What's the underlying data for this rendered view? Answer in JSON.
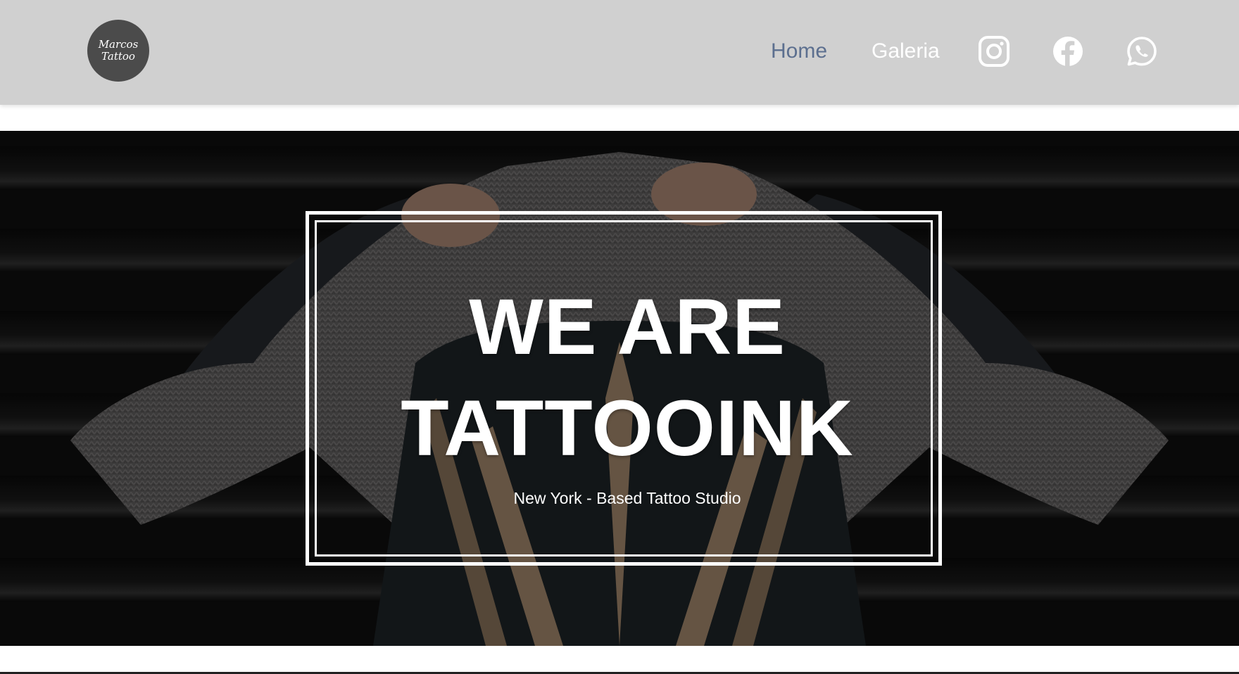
{
  "header": {
    "logo": {
      "line1": "Marcos",
      "line2": "Tattoo"
    },
    "nav": [
      {
        "label": "Home",
        "active": true
      },
      {
        "label": "Galeria",
        "active": false
      }
    ],
    "social": [
      {
        "name": "instagram-icon"
      },
      {
        "name": "facebook-icon"
      },
      {
        "name": "whatsapp-icon"
      }
    ]
  },
  "hero": {
    "title_line1": "WE ARE",
    "title_line2": "TATTOOINK",
    "subtitle": "New York - Based Tattoo Studio"
  },
  "colors": {
    "navbar_bg": "#d0d0d0",
    "nav_active": "#5c6f8f",
    "nav_inactive": "#ffffff",
    "logo_bg": "#4b4b4b"
  }
}
